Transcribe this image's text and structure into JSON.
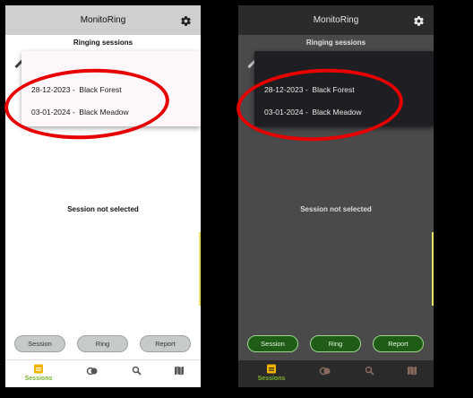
{
  "light": {
    "app_title": "MonitoRing",
    "section_title": "Ringing sessions",
    "sessions": [
      {
        "date": "28-12-2023",
        "name": "Black Forest",
        "label": "28-12-2023 -  Black Forest"
      },
      {
        "date": "03-01-2024",
        "name": "Black Meadow",
        "label": "03-01-2024 -  Black Meadow"
      }
    ],
    "empty_message": "Session not selected",
    "buttons": {
      "session": "Session",
      "ring": "Ring",
      "report": "Report"
    },
    "nav": {
      "sessions": "Sessions"
    }
  },
  "dark": {
    "app_title": "MonitoRing",
    "section_title": "Ringing sessions",
    "sessions": [
      {
        "date": "28-12-2023",
        "name": "Black Forest",
        "label": "28-12-2023 -  Black Forest"
      },
      {
        "date": "03-01-2024",
        "name": "Black Meadow",
        "label": "03-01-2024 -  Black Meadow"
      }
    ],
    "empty_message": "Session not selected",
    "buttons": {
      "session": "Session",
      "ring": "Ring",
      "report": "Report"
    },
    "nav": {
      "sessions": "Sessions"
    }
  },
  "icons": [
    "gear-icon",
    "edit-icon",
    "sessions-icon",
    "rings-icon",
    "search-icon",
    "map-icon"
  ],
  "colors": {
    "annotation_circle": "#e60000",
    "accent_green": "#7ab32e",
    "dark_button": "#1f5d17",
    "light_appbar": "#cfcfcf",
    "dark_appbar": "#2b2b2b"
  }
}
